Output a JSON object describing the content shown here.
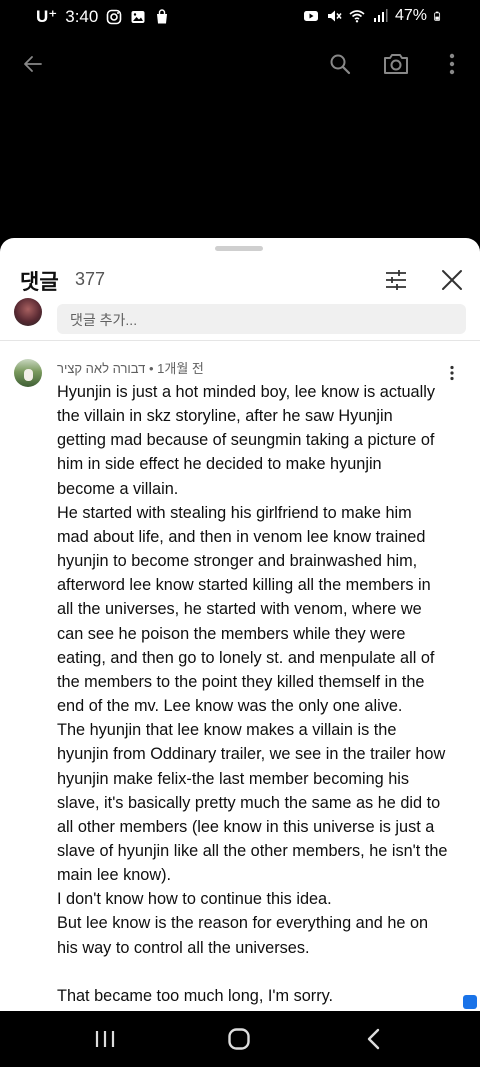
{
  "status_bar": {
    "carrier": "U⁺",
    "time": "3:40",
    "battery": "47%"
  },
  "sheet": {
    "title": "댓글",
    "count": "377",
    "add_comment_placeholder": "댓글 추가..."
  },
  "comment": {
    "author": "דבורה לאה קציר",
    "age": "1개월 전",
    "separator": "•",
    "lines": [
      "Hyunjin is just a hot minded boy, lee know is actually",
      "the villain in skz storyline, after he saw Hyunjin",
      "getting mad because of seungmin taking a picture of",
      "him in side effect he decided to make hyunjin",
      "become a villain.",
      "He started with stealing his girlfriend to make him",
      "mad about life, and then in venom lee know trained",
      "hyunjin to become stronger and brainwashed him,",
      "afterword lee know started killing all the members in",
      "all the universes, he started with venom, where we",
      "can see he poison the members while they were",
      "eating, and then go to lonely st. and menpulate all of",
      "the members to the point they killed themself in the",
      "end of the mv. Lee know was the only one alive.",
      "The hyunjin that lee know makes a villain is the",
      "hyunjin from Oddinary trailer, we see in the trailer how",
      "hyunjin make felix-the last member becoming his",
      "slave, it's basically pretty much the same as he did to",
      "all other members (lee know in this universe is just a",
      "slave of hyunjin like all the other members, he isn't the",
      "main lee know).",
      "I don't know how to continue this idea.",
      "But lee know is the reason for everything and he on",
      "his way to control all the universes.",
      "",
      "That became too much long, I'm sorry."
    ]
  },
  "icons": {
    "back": "arrow-left-icon",
    "search": "search-icon",
    "camera": "camera-icon",
    "more": "more-vert-icon",
    "filter": "tune-icon",
    "close": "close-icon",
    "nav_recents": "recents-icon",
    "nav_home": "home-icon",
    "nav_back": "nav-back-icon"
  },
  "colors": {
    "sheet_bg": "#ffffff",
    "secondary_text": "#606060",
    "field_bg": "#f0f0f0"
  }
}
